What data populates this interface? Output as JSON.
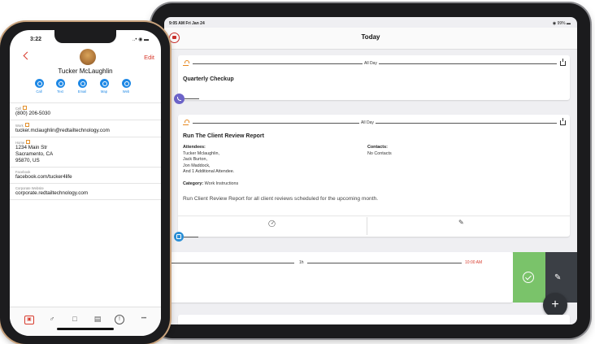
{
  "ipad": {
    "status": {
      "time": "9:05 AM  Fri Jan 24",
      "battery": "◉ 99% ▬"
    },
    "nav_title": "Today",
    "events": [
      {
        "tag": "All Day",
        "title": "Quarterly Checkup"
      },
      {
        "tag": "All Day",
        "title": "Run The Client Review Report",
        "attendees_label": "Attendees:",
        "attendees": [
          "Tucker Mclaughlin,",
          "Jack Burton,",
          "Jon Maddock,",
          "And 1 Additional Attendee."
        ],
        "contacts_label": "Contacts:",
        "contacts_value": "No Contacts",
        "category_label": "Category:",
        "category_value": "Work Instructions",
        "description": "Run Client Review Report for all client reviews scheduled for the upcoming month.",
        "complete_icon": "check-circle-icon",
        "edit_icon": "pencil-icon"
      },
      {
        "duration": "1h",
        "time": "10:00 AM"
      }
    ],
    "swipe_actions": {
      "complete_icon": "check-circle-icon",
      "edit_icon": "pencil-icon"
    },
    "fab_label": "+",
    "colors": {
      "accent_red": "#d83b2d",
      "green": "#7ac36a",
      "purple": "#6c63c8",
      "blue": "#2a8fd6",
      "orange": "#e6871f"
    }
  },
  "iphone": {
    "status": {
      "time": "3:22",
      "signal": "..• ◉ ▬"
    },
    "edit_label": "Edit",
    "contact_name": "Tucker  McLaughlin",
    "actions": [
      "Call",
      "Text",
      "Email",
      "Map",
      "Web"
    ],
    "fields": [
      {
        "label": "Cell",
        "value": "(800) 206-5030",
        "flag": true
      },
      {
        "label": "Work",
        "value": "tucker.mclaughlin@redtailtechnology.com",
        "flag": true
      },
      {
        "label": "Home",
        "value": "1234 Main Str\nSacramento, CA\n95870, US",
        "flag": true
      },
      {
        "label": "Facebook",
        "value": "facebook.com/tucker4life",
        "flag": false
      },
      {
        "label": "Corporate Website",
        "value": "corporate.redtailtechnology.com",
        "flag": false
      }
    ],
    "tabs": [
      "contact-card-icon",
      "person-icon",
      "calendar-icon",
      "notes-icon",
      "alert-icon",
      "more-icon"
    ],
    "tab_glyphs": [
      "▣",
      "♂",
      "□",
      "▤",
      "!",
      "•••"
    ]
  }
}
